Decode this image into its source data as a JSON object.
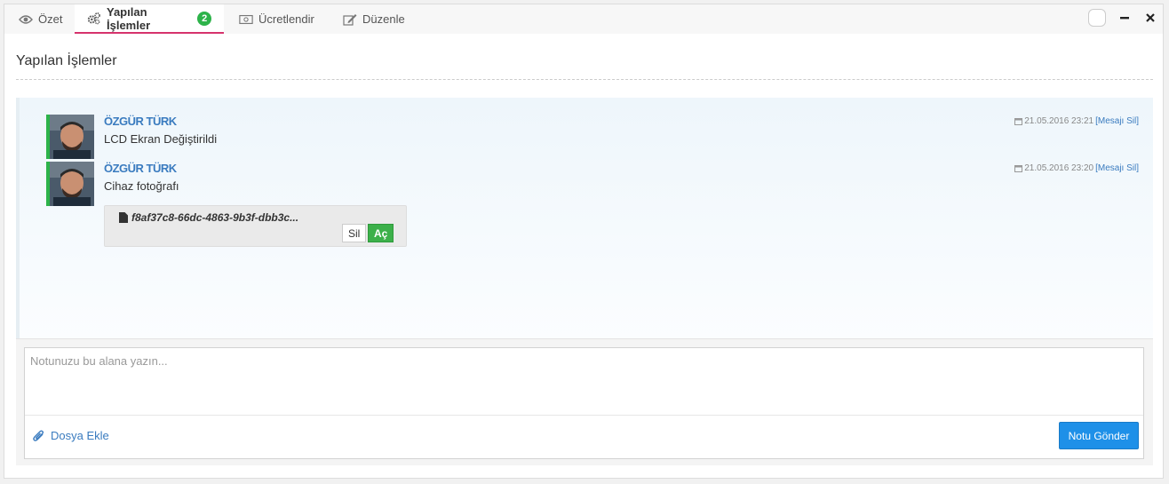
{
  "tabs": [
    {
      "label": "Özet",
      "icon": "eye-icon"
    },
    {
      "label": "Yapılan İşlemler",
      "icon": "gears-icon",
      "badge": "2"
    },
    {
      "label": "Ücretlendir",
      "icon": "money-icon"
    },
    {
      "label": "Düzenle",
      "icon": "edit-icon"
    }
  ],
  "section": {
    "title": "Yapılan İşlemler"
  },
  "messages": [
    {
      "author": "ÖZGÜR TÜRK",
      "text": "LCD Ekran Değiştirildi",
      "date": "21.05.2016 23:21",
      "delete_label": "[Mesajı Sil]"
    },
    {
      "author": "ÖZGÜR TÜRK",
      "text": "Cihaz fotoğrafı",
      "date": "21.05.2016 23:20",
      "delete_label": "[Mesajı Sil]",
      "attachment": {
        "filename": "f8af37c8-66dc-4863-9b3f-dbb3c...",
        "delete_label": "Sil",
        "open_label": "Aç"
      }
    }
  ],
  "composer": {
    "placeholder": "Notunuzu bu alana yazın...",
    "attach_label": "Dosya Ekle",
    "send_label": "Notu Gönder"
  },
  "colors": {
    "accent": "#d6336c",
    "badge": "#2db34a",
    "link": "#3a7bbf",
    "send": "#1e90e8"
  }
}
